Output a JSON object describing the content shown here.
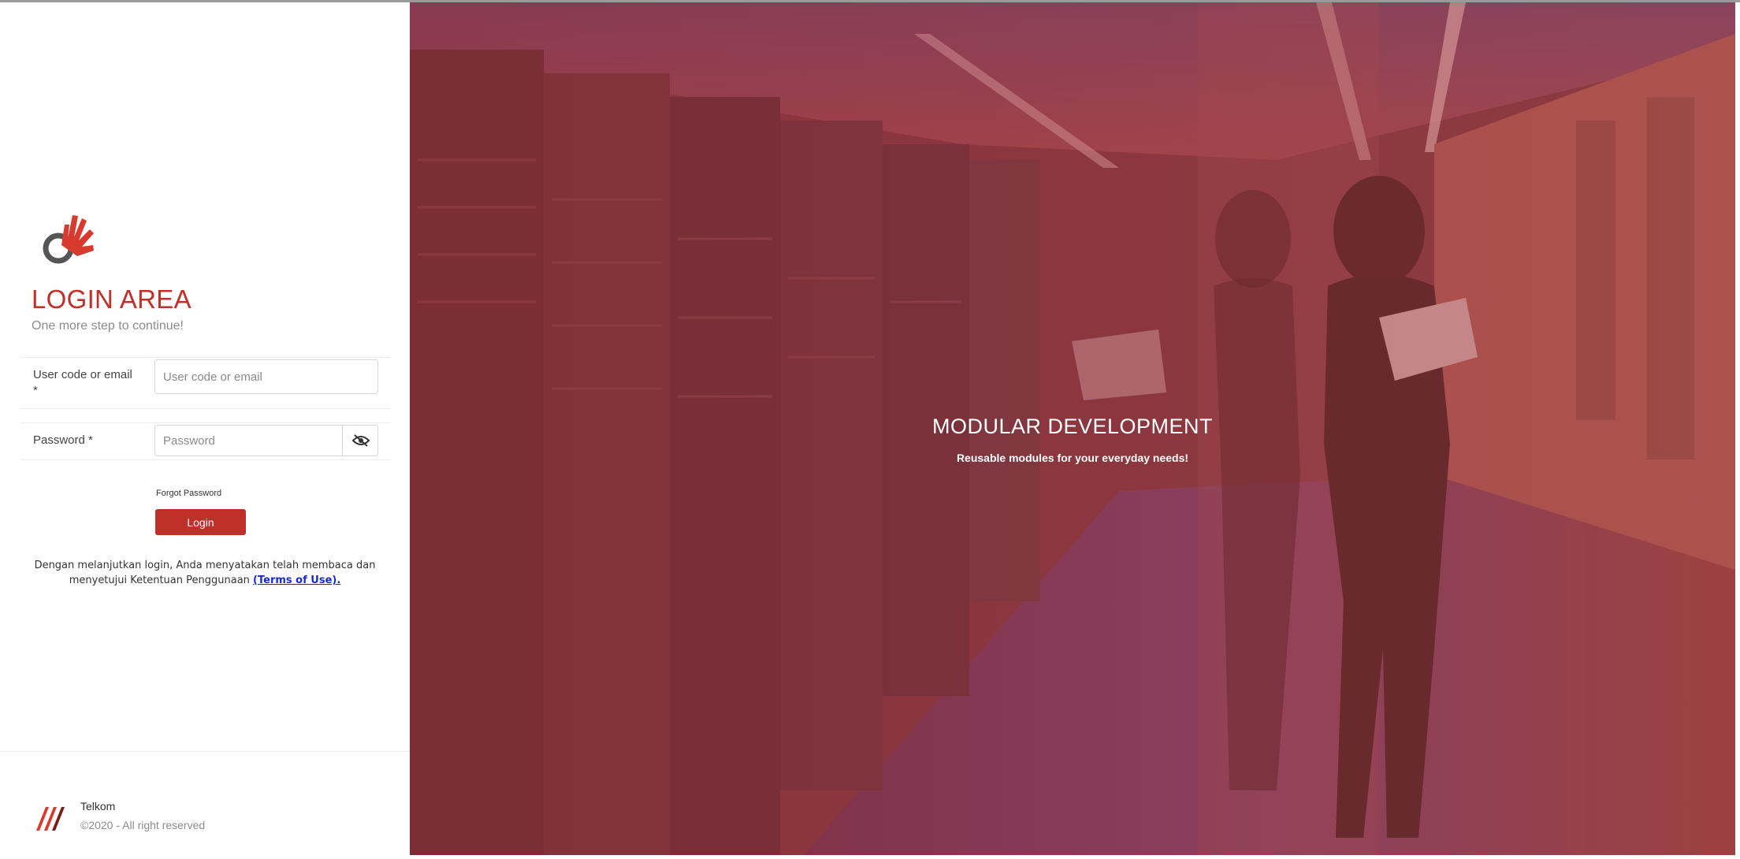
{
  "login": {
    "title": "LOGIN AREA",
    "subtitle": "One more step to continue!",
    "user_label": "User code or email",
    "user_required": "*",
    "user_placeholder": "User code or email",
    "password_label": "Password *",
    "password_placeholder": "Password",
    "forgot_label": "Forgot Password",
    "login_button": "Login",
    "terms_text": "Dengan melanjutkan login, Anda menyatakan telah membaca dan menyetujui Ketentuan Penggunaan",
    "terms_link": "(Terms of Use)."
  },
  "footer": {
    "company": "Telkom",
    "copyright": "©2020 - All right reserved"
  },
  "hero": {
    "title": "MODULAR DEVELOPMENT",
    "subtitle": "Reusable modules for your everyday needs!"
  },
  "icons": {
    "logo": "hand-logo-icon",
    "eye": "eye-off-icon",
    "telkom": "telkom-logo-icon"
  },
  "colors": {
    "accent": "#c0302a",
    "link": "#1a2bc8",
    "hero_overlay": "#a0353a"
  }
}
